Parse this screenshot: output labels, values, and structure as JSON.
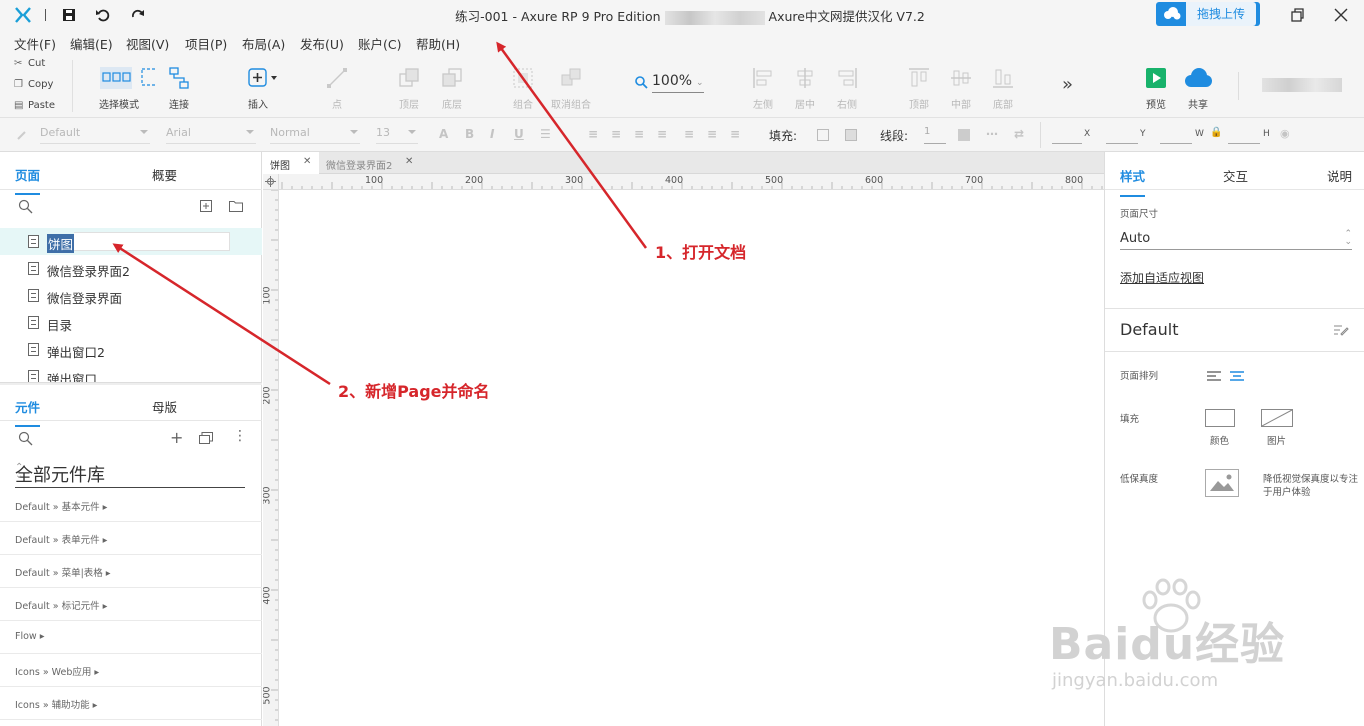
{
  "window": {
    "title_left": "练习-001 - Axure RP 9 Pro Edition",
    "title_right": "Axure中文网提供汉化 V7.2",
    "upload_label": "拖拽上传"
  },
  "menu": [
    "文件(F)",
    "编辑(E)",
    "视图(V)",
    "项目(P)",
    "布局(A)",
    "发布(U)",
    "账户(C)",
    "帮助(H)"
  ],
  "clipboard": {
    "cut": "Cut",
    "copy": "Copy",
    "paste": "Paste"
  },
  "toolbar": {
    "select_mode": "选择模式",
    "connect": "连接",
    "insert": "插入",
    "point": "点",
    "top_layer": "顶层",
    "bottom_layer": "底层",
    "group": "组合",
    "ungroup": "取消组合",
    "zoom": "100%",
    "align_left": "左侧",
    "align_center": "居中",
    "align_right": "右侧",
    "align_top": "顶部",
    "align_middle": "中部",
    "align_bottom": "底部",
    "preview": "预览",
    "share": "共享"
  },
  "format": {
    "style": "Default",
    "font": "Arial",
    "weight": "Normal",
    "size": "13",
    "fill_label": "填充:",
    "stroke_label": "线段:",
    "stroke_value": "1",
    "x": "X",
    "y": "Y",
    "w": "W",
    "h": "H"
  },
  "left_panel": {
    "tab_pages": "页面",
    "tab_outline": "概要",
    "pages": [
      "饼图",
      "微信登录界面2",
      "微信登录界面",
      "目录",
      "弹出窗口2",
      "弹出窗口"
    ],
    "tab_widgets": "元件",
    "tab_masters": "母版",
    "library": "全部元件库",
    "libraries": [
      "Default » 基本元件 ▸",
      "Default » 表单元件 ▸",
      "Default » 菜单|表格 ▸",
      "Default » 标记元件 ▸",
      "Flow ▸",
      "Icons » Web应用 ▸",
      "Icons » 辅助功能 ▸"
    ]
  },
  "doc_tabs": [
    "饼图",
    "微信登录界面2"
  ],
  "ruler": {
    "h": [
      "100",
      "200",
      "300",
      "400",
      "500",
      "600",
      "700",
      "800"
    ],
    "v": [
      "100",
      "200",
      "300",
      "400",
      "500"
    ]
  },
  "right_panel": {
    "tab_style": "样式",
    "tab_interact": "交互",
    "tab_notes": "说明",
    "page_size_label": "页面尺寸",
    "page_size_value": "Auto",
    "adaptive_link": "添加自适应视图",
    "style_name": "Default",
    "arrange_label": "页面排列",
    "fill_label": "填充",
    "fill_color": "颜色",
    "fill_image": "图片",
    "lowfi_label": "低保真度",
    "lowfi_desc_1": "降低视觉保真度以专注",
    "lowfi_desc_2": "于用户体验"
  },
  "annotations": {
    "a1": "1、打开文档",
    "a2": "2、新增Page并命名"
  },
  "watermark": {
    "brand": "Baidu经验",
    "url": "jingyan.baidu.com"
  },
  "colors": {
    "accent": "#1f8ce0",
    "annotation": "#d6262b",
    "selection": "#3f6fa8"
  }
}
